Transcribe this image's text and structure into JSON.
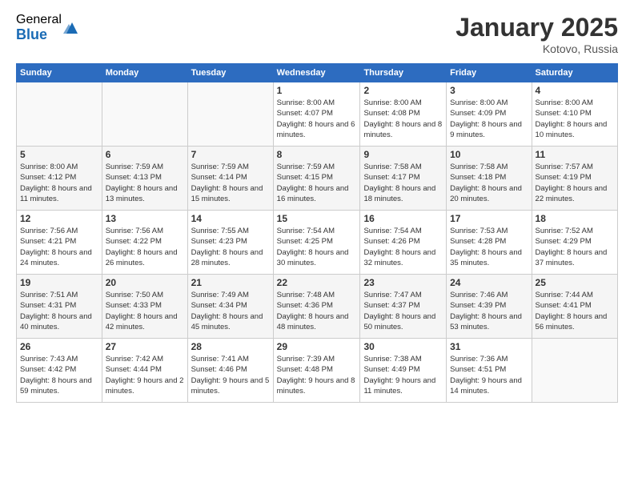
{
  "logo": {
    "general": "General",
    "blue": "Blue"
  },
  "title": "January 2025",
  "location": "Kotovo, Russia",
  "days_header": [
    "Sunday",
    "Monday",
    "Tuesday",
    "Wednesday",
    "Thursday",
    "Friday",
    "Saturday"
  ],
  "weeks": [
    [
      {
        "day": "",
        "info": ""
      },
      {
        "day": "",
        "info": ""
      },
      {
        "day": "",
        "info": ""
      },
      {
        "day": "1",
        "info": "Sunrise: 8:00 AM\nSunset: 4:07 PM\nDaylight: 8 hours and 6 minutes."
      },
      {
        "day": "2",
        "info": "Sunrise: 8:00 AM\nSunset: 4:08 PM\nDaylight: 8 hours and 8 minutes."
      },
      {
        "day": "3",
        "info": "Sunrise: 8:00 AM\nSunset: 4:09 PM\nDaylight: 8 hours and 9 minutes."
      },
      {
        "day": "4",
        "info": "Sunrise: 8:00 AM\nSunset: 4:10 PM\nDaylight: 8 hours and 10 minutes."
      }
    ],
    [
      {
        "day": "5",
        "info": "Sunrise: 8:00 AM\nSunset: 4:12 PM\nDaylight: 8 hours and 11 minutes."
      },
      {
        "day": "6",
        "info": "Sunrise: 7:59 AM\nSunset: 4:13 PM\nDaylight: 8 hours and 13 minutes."
      },
      {
        "day": "7",
        "info": "Sunrise: 7:59 AM\nSunset: 4:14 PM\nDaylight: 8 hours and 15 minutes."
      },
      {
        "day": "8",
        "info": "Sunrise: 7:59 AM\nSunset: 4:15 PM\nDaylight: 8 hours and 16 minutes."
      },
      {
        "day": "9",
        "info": "Sunrise: 7:58 AM\nSunset: 4:17 PM\nDaylight: 8 hours and 18 minutes."
      },
      {
        "day": "10",
        "info": "Sunrise: 7:58 AM\nSunset: 4:18 PM\nDaylight: 8 hours and 20 minutes."
      },
      {
        "day": "11",
        "info": "Sunrise: 7:57 AM\nSunset: 4:19 PM\nDaylight: 8 hours and 22 minutes."
      }
    ],
    [
      {
        "day": "12",
        "info": "Sunrise: 7:56 AM\nSunset: 4:21 PM\nDaylight: 8 hours and 24 minutes."
      },
      {
        "day": "13",
        "info": "Sunrise: 7:56 AM\nSunset: 4:22 PM\nDaylight: 8 hours and 26 minutes."
      },
      {
        "day": "14",
        "info": "Sunrise: 7:55 AM\nSunset: 4:23 PM\nDaylight: 8 hours and 28 minutes."
      },
      {
        "day": "15",
        "info": "Sunrise: 7:54 AM\nSunset: 4:25 PM\nDaylight: 8 hours and 30 minutes."
      },
      {
        "day": "16",
        "info": "Sunrise: 7:54 AM\nSunset: 4:26 PM\nDaylight: 8 hours and 32 minutes."
      },
      {
        "day": "17",
        "info": "Sunrise: 7:53 AM\nSunset: 4:28 PM\nDaylight: 8 hours and 35 minutes."
      },
      {
        "day": "18",
        "info": "Sunrise: 7:52 AM\nSunset: 4:29 PM\nDaylight: 8 hours and 37 minutes."
      }
    ],
    [
      {
        "day": "19",
        "info": "Sunrise: 7:51 AM\nSunset: 4:31 PM\nDaylight: 8 hours and 40 minutes."
      },
      {
        "day": "20",
        "info": "Sunrise: 7:50 AM\nSunset: 4:33 PM\nDaylight: 8 hours and 42 minutes."
      },
      {
        "day": "21",
        "info": "Sunrise: 7:49 AM\nSunset: 4:34 PM\nDaylight: 8 hours and 45 minutes."
      },
      {
        "day": "22",
        "info": "Sunrise: 7:48 AM\nSunset: 4:36 PM\nDaylight: 8 hours and 48 minutes."
      },
      {
        "day": "23",
        "info": "Sunrise: 7:47 AM\nSunset: 4:37 PM\nDaylight: 8 hours and 50 minutes."
      },
      {
        "day": "24",
        "info": "Sunrise: 7:46 AM\nSunset: 4:39 PM\nDaylight: 8 hours and 53 minutes."
      },
      {
        "day": "25",
        "info": "Sunrise: 7:44 AM\nSunset: 4:41 PM\nDaylight: 8 hours and 56 minutes."
      }
    ],
    [
      {
        "day": "26",
        "info": "Sunrise: 7:43 AM\nSunset: 4:42 PM\nDaylight: 8 hours and 59 minutes."
      },
      {
        "day": "27",
        "info": "Sunrise: 7:42 AM\nSunset: 4:44 PM\nDaylight: 9 hours and 2 minutes."
      },
      {
        "day": "28",
        "info": "Sunrise: 7:41 AM\nSunset: 4:46 PM\nDaylight: 9 hours and 5 minutes."
      },
      {
        "day": "29",
        "info": "Sunrise: 7:39 AM\nSunset: 4:48 PM\nDaylight: 9 hours and 8 minutes."
      },
      {
        "day": "30",
        "info": "Sunrise: 7:38 AM\nSunset: 4:49 PM\nDaylight: 9 hours and 11 minutes."
      },
      {
        "day": "31",
        "info": "Sunrise: 7:36 AM\nSunset: 4:51 PM\nDaylight: 9 hours and 14 minutes."
      },
      {
        "day": "",
        "info": ""
      }
    ]
  ]
}
